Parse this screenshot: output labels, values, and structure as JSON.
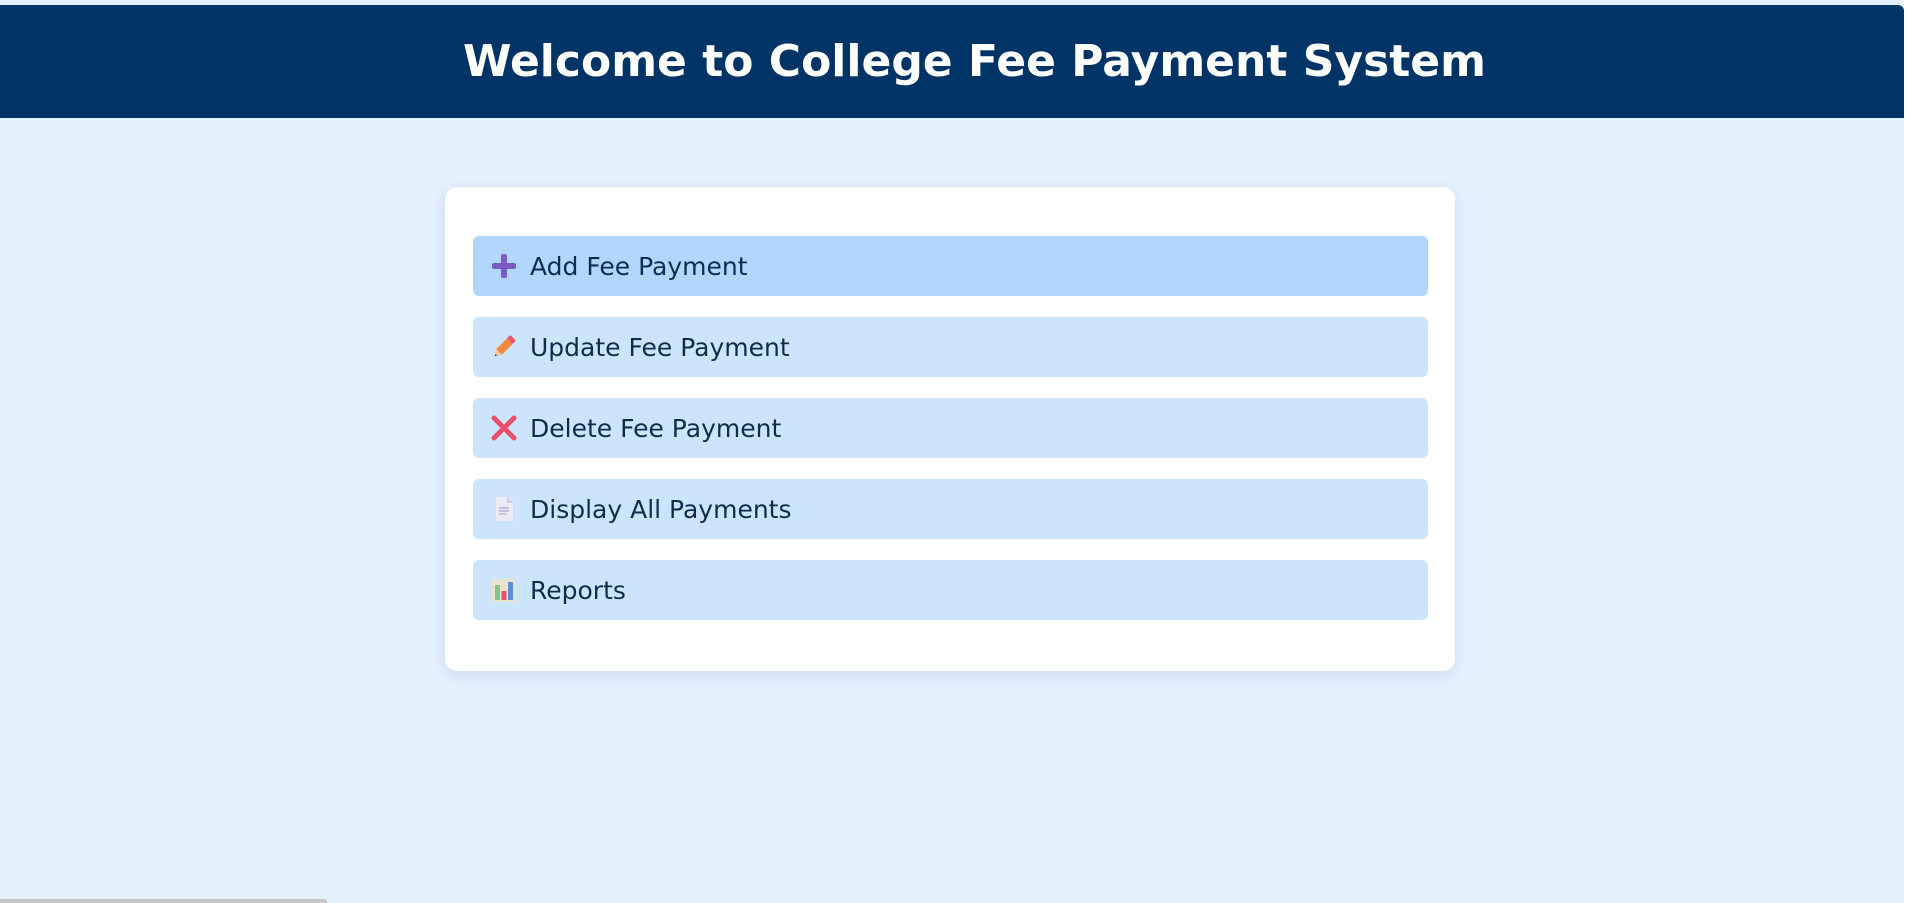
{
  "header": {
    "title": "Welcome to College Fee Payment System"
  },
  "menu": {
    "items": [
      {
        "label": "Add Fee Payment",
        "icon": "plus-icon",
        "active": true
      },
      {
        "label": "Update Fee Payment",
        "icon": "pencil-icon",
        "active": false
      },
      {
        "label": "Delete Fee Payment",
        "icon": "cross-icon",
        "active": false
      },
      {
        "label": "Display All Payments",
        "icon": "document-icon",
        "active": false
      },
      {
        "label": "Reports",
        "icon": "bar-chart-icon",
        "active": false
      }
    ]
  },
  "colors": {
    "header_bg": "#003366",
    "page_bg": "#e3f0fe",
    "button_bg": "#cce5fd",
    "button_active_bg": "#b1d7fd",
    "label_text": "#0f2d4a"
  }
}
